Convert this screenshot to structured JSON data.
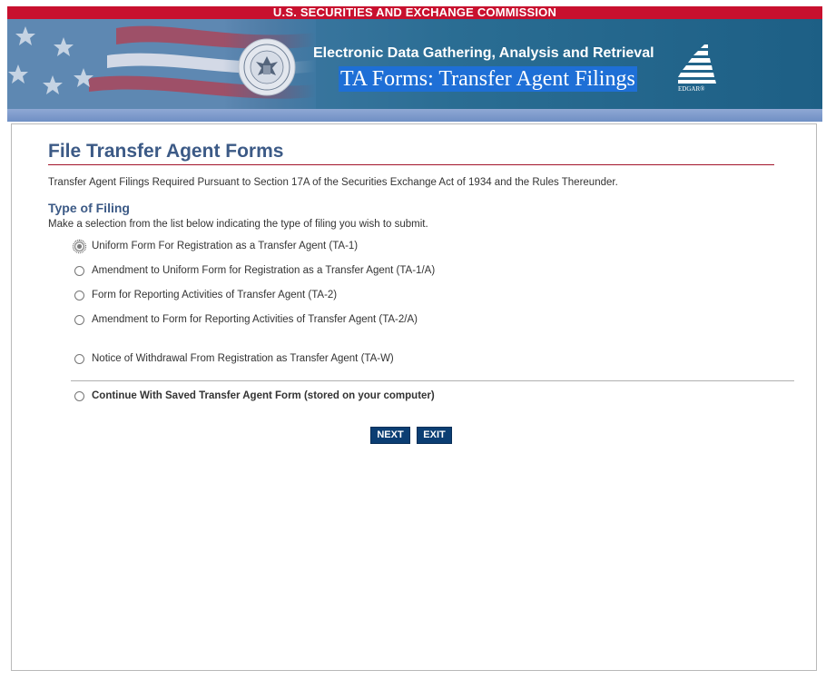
{
  "header": {
    "agency": "U.S. SECURITIES AND EXCHANGE COMMISSION",
    "system_name": "Electronic Data Gathering, Analysis and Retrieval",
    "form_title": "TA Forms: Transfer Agent Filings",
    "logo_text": "EDGAR®"
  },
  "icons": {
    "seal": "sec-seal-icon",
    "logo": "edgar-logo-icon",
    "flag": "flag-graphic"
  },
  "colors": {
    "top_bar": "#c8102e",
    "title": "#3c5a86",
    "button": "#0b3e73",
    "highlight": "#1e6fd6"
  },
  "main": {
    "page_title": "File Transfer Agent Forms",
    "intro": "Transfer Agent Filings Required Pursuant to Section 17A of the Securities Exchange Act of 1934 and the Rules Thereunder.",
    "section_title": "Type of Filing",
    "instruction": "Make a selection from the list below indicating the type of filing you wish to submit.",
    "options": [
      {
        "label": "Uniform Form For Registration as a Transfer Agent (TA-1)",
        "selected": true
      },
      {
        "label": "Amendment to Uniform Form for Registration as a Transfer Agent (TA-1/A)",
        "selected": false
      },
      {
        "label": "Form for Reporting Activities of Transfer Agent (TA-2)",
        "selected": false
      },
      {
        "label": "Amendment to Form for Reporting Activities of Transfer Agent (TA-2/A)",
        "selected": false
      },
      {
        "label": "Notice of Withdrawal From Registration as Transfer Agent (TA-W)",
        "selected": false
      },
      {
        "label": "Continue With Saved Transfer Agent Form (stored on your computer)",
        "selected": false
      }
    ],
    "buttons": {
      "next": "NEXT",
      "exit": "EXIT"
    }
  }
}
